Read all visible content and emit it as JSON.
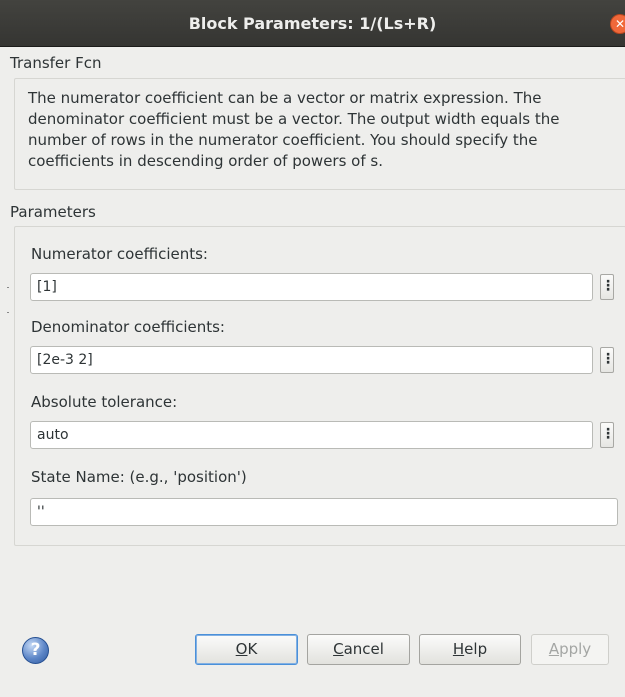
{
  "window": {
    "title": "Block Parameters: 1/(Ls+R)",
    "close_icon": "close-icon"
  },
  "block": {
    "type_label": "Transfer Fcn",
    "description": "The numerator coefficient can be a vector or matrix expression. The denominator coefficient must be a vector. The output width equals the number of rows in the numerator coefficient. You should specify the coefficients in descending order of powers of s."
  },
  "parameters": {
    "section_label": "Parameters",
    "numerator": {
      "label": "Numerator coefficients:",
      "value": "[1]",
      "menu_glyph": "⋮"
    },
    "denominator": {
      "label": "Denominator coefficients:",
      "value": "[2e-3 2]",
      "menu_glyph": "⋮"
    },
    "abs_tol": {
      "label": "Absolute tolerance:",
      "value": "auto",
      "menu_glyph": "⋮"
    },
    "state_name": {
      "label": "State Name: (e.g., 'position')",
      "value": "''"
    }
  },
  "buttons": {
    "help_icon_glyph": "?",
    "ok": {
      "mnemonic": "O",
      "rest": "K"
    },
    "cancel": {
      "mnemonic": "C",
      "rest": "ancel"
    },
    "help": {
      "mnemonic": "H",
      "rest": "elp"
    },
    "apply": {
      "mnemonic": "A",
      "rest": "pply"
    }
  },
  "colors": {
    "titlebar": "#3c3c39",
    "window_bg": "#eeeeec",
    "close_button": "#f0683a",
    "default_button_border": "#4a90d9",
    "disabled_text": "#a4a6a4"
  }
}
